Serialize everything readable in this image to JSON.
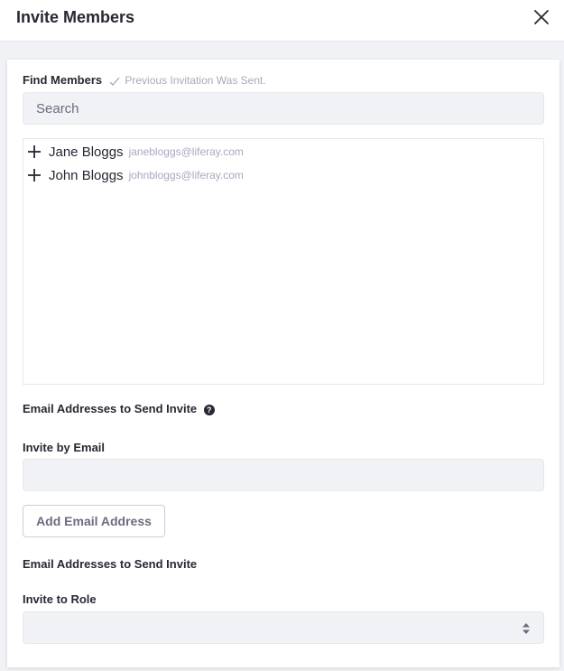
{
  "modal": {
    "title": "Invite Members"
  },
  "find": {
    "label": "Find Members",
    "sent_note": "Previous Invitation Was Sent.",
    "search_placeholder": "Search"
  },
  "members": [
    {
      "name": "Jane Bloggs",
      "email": "janebloggs@liferay.com"
    },
    {
      "name": "John Bloggs",
      "email": "johnbloggs@liferay.com"
    }
  ],
  "email_section": {
    "label": "Email Addresses to Send Invite",
    "help_glyph": "?",
    "invite_by_email_label": "Invite by Email",
    "invite_by_email_value": "",
    "add_button_label": "Add Email Address",
    "list_label": "Email Addresses to Send Invite"
  },
  "role": {
    "label": "Invite to Role",
    "selected": ""
  },
  "icons": {
    "close": "close-icon",
    "check": "check-icon",
    "plus": "plus-icon",
    "help": "question-circle-icon",
    "select": "caret-double-icon"
  },
  "colors": {
    "text": "#272833",
    "muted": "#a7a9bc",
    "field_bg": "#f1f2f5",
    "border": "#e7e7ed"
  }
}
